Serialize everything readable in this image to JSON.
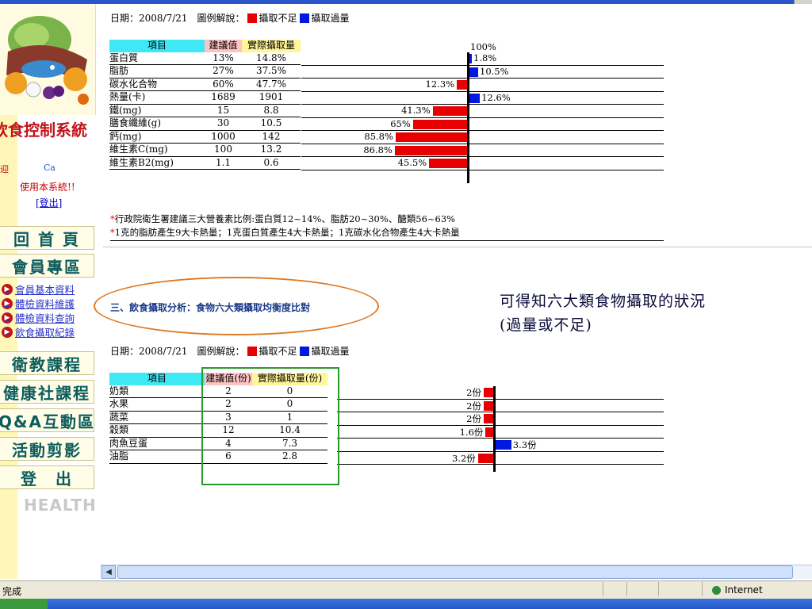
{
  "sidebar": {
    "system_title": "飲食控制系統",
    "welcome": "迎",
    "user_name": "Ca",
    "user_msg": "使用本系統!!",
    "logout": "[登出]",
    "nav": [
      {
        "label": "回 首 頁"
      },
      {
        "label": "會員專區"
      }
    ],
    "sub_items": [
      {
        "label": "會員基本資料"
      },
      {
        "label": "體檢資料維護"
      },
      {
        "label": "體檢資料查詢"
      },
      {
        "label": "飲食攝取紀錄"
      }
    ],
    "nav2": [
      {
        "label": "衛教課程"
      },
      {
        "label": "健康社課程"
      },
      {
        "label": "Q&A互動區"
      },
      {
        "label": "活動剪影"
      },
      {
        "label": "登　出"
      }
    ],
    "health": "HEALTH"
  },
  "nutrients": {
    "date_line": "日期：2008/7/21　圖例解說：",
    "legend_under": "攝取不足",
    "legend_over": "攝取過量",
    "axis_label": "100%",
    "headers": {
      "item": "項目",
      "rec": "建議值",
      "act": "實際攝取量"
    },
    "rows": [
      {
        "item": "蛋白質",
        "rec": "13%",
        "act": "14.8%",
        "pct": "1.8%",
        "dir": "over",
        "value": 1.8
      },
      {
        "item": "脂肪",
        "rec": "27%",
        "act": "37.5%",
        "pct": "10.5%",
        "dir": "over",
        "value": 10.5
      },
      {
        "item": "碳水化合物",
        "rec": "60%",
        "act": "47.7%",
        "pct": "12.3%",
        "dir": "under",
        "value": 12.3
      },
      {
        "item": "熱量(卡)",
        "rec": "1689",
        "act": "1901",
        "pct": "12.6%",
        "dir": "over",
        "value": 12.6
      },
      {
        "item": "鐵(mg)",
        "rec": "15",
        "act": "8.8",
        "pct": "41.3%",
        "dir": "under",
        "value": 41.3
      },
      {
        "item": "膳食纖維(g)",
        "rec": "30",
        "act": "10.5",
        "pct": "65%",
        "dir": "under",
        "value": 65
      },
      {
        "item": "鈣(mg)",
        "rec": "1000",
        "act": "142",
        "pct": "85.8%",
        "dir": "under",
        "value": 85.8
      },
      {
        "item": "維生素C(mg)",
        "rec": "100",
        "act": "13.2",
        "pct": "86.8%",
        "dir": "under",
        "value": 86.8
      },
      {
        "item": "維生素B2(mg)",
        "rec": "1.1",
        "act": "0.6",
        "pct": "45.5%",
        "dir": "under",
        "value": 45.5
      }
    ],
    "note1": "行政院衛生署建議三大營養素比例:蛋白質12~14%、脂肪20~30%、醣類56~63%",
    "note2": "1克的脂肪產生9大卡熱量；1克蛋白質產生4大卡熱量；1克碳水化合物產生4大卡熱量"
  },
  "section3": {
    "title": "三、飲食攝取分析：食物六大類攝取均衡度比對",
    "annotation_line1": "可得知六大類食物攝取的狀況",
    "annotation_line2": "(過量或不足)"
  },
  "food": {
    "date_line": "日期：2008/7/21　圖例解說：",
    "legend_under": "攝取不足",
    "legend_over": "攝取過量",
    "headers": {
      "item": "項目",
      "rec": "建議值(份)",
      "act": "實際攝取量(份)"
    },
    "rows": [
      {
        "item": "奶類",
        "rec": "2",
        "act": "0",
        "pct": "2份",
        "dir": "under",
        "value": 2
      },
      {
        "item": "水果",
        "rec": "2",
        "act": "0",
        "pct": "2份",
        "dir": "under",
        "value": 2
      },
      {
        "item": "蔬菜",
        "rec": "3",
        "act": "1",
        "pct": "2份",
        "dir": "under",
        "value": 2
      },
      {
        "item": "穀類",
        "rec": "12",
        "act": "10.4",
        "pct": "1.6份",
        "dir": "under",
        "value": 1.6
      },
      {
        "item": "肉魚豆蛋",
        "rec": "4",
        "act": "7.3",
        "pct": "3.3份",
        "dir": "over",
        "value": 3.3
      },
      {
        "item": "油脂",
        "rec": "6",
        "act": "2.8",
        "pct": "3.2份",
        "dir": "under",
        "value": 3.2
      }
    ]
  },
  "status": {
    "text": "完成",
    "zone": "Internet"
  },
  "colors": {
    "under": "#e80000",
    "over": "#0018e0"
  }
}
